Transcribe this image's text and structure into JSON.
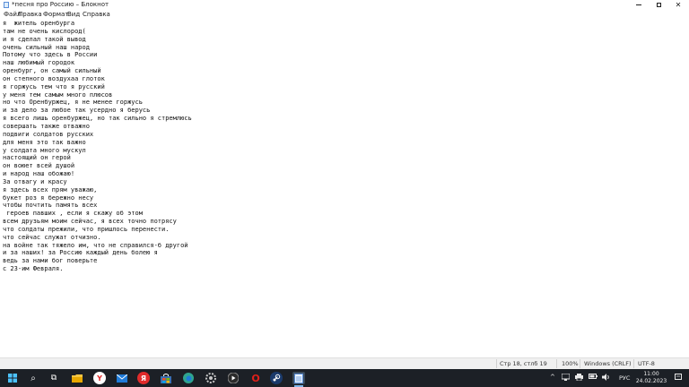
{
  "window": {
    "title": "*песня про Россию – Блокнот",
    "minimize_glyph": "–",
    "close_glyph": "✕"
  },
  "menu": {
    "items": [
      "Файл",
      "Правка",
      "Формат",
      "Вид",
      "Справка"
    ]
  },
  "document": {
    "lines": [
      "я  житель оренбурга",
      "там не очень кислород(",
      "и я сделал такой вывод",
      "очень сильный наш народ",
      "Потому что здесь в России",
      "наш любимый городок",
      "оренбург, он самый сильный",
      "он степного воздухаа глоток",
      "я горжусь тем что я русский",
      "у меня тем самым много плюсов",
      "но что Оренбуржец, я не менее горжусь",
      "и за дело за любое так усердно я берусь",
      "я всего лишь оренбуржец, но так сильно я стремлюсь",
      "совершать также отважно",
      "подвиги солдатов русских",
      "для меня это так важно",
      "у солдата много мускул",
      "настоящий он герой",
      "он воюет всей душой",
      "и народ наш обожаю!",
      "За отвагу и красу",
      "я здесь всех прям уважаю,",
      "букет роз я бережно несу",
      "чтобы почтить память всех",
      " героев павших , если я скажу об этом",
      "всем друзьям моим сейчас, я всех точно потрясу",
      "что солдаты прежили, что пришлось перенести.",
      "что сейчас служат отчизно.",
      "на войне так тяжело им, что не справился-б другой",
      "и за наших! за Россию каждый день болею я",
      "ведь за нами бог поверьте",
      "с 23-им Февраля."
    ]
  },
  "statusbar": {
    "position": "Стр 18, стлб 19",
    "zoom": "100%",
    "line_endings": "Windows (CRLF)",
    "encoding": "UTF-8"
  },
  "taskbar": {
    "search_glyph": "⌕",
    "taskview_glyph": "⧉",
    "yandex_letter": "Y",
    "yandex_browser_letter": "Я",
    "opera_letter": "O",
    "tray_chevron": "^",
    "language": "РУС",
    "time": "11:00",
    "date": "24.02.2023"
  },
  "colors": {
    "taskbar_bg": "#1c2026",
    "statusbar_bg": "#f0f0f0",
    "start_accent": "#4cc2ff",
    "explorer": "#f4c542",
    "yandex_red": "#e02b2b",
    "mail_blue": "#1f7bd8",
    "edge_teal": "#2fa58f",
    "opera_red": "#e0201a",
    "steam_blue": "#1b3a6b",
    "notepad_active": "#7fb6ea"
  }
}
